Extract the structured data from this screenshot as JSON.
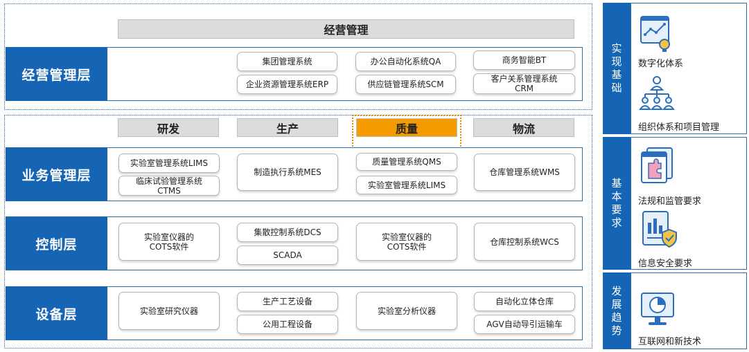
{
  "top": {
    "header": "经营管理",
    "label": "经营管理层",
    "boxes": [
      "集团管理系统",
      "企业资源管理系统ERP",
      "办公自动化系统QA",
      "供应链管理系统SCM",
      "商务智能BT",
      "客户关系管理系统\nCRM"
    ]
  },
  "columns": [
    "研发",
    "生产",
    "质量",
    "物流"
  ],
  "business": {
    "label": "业务管理层",
    "boxes": [
      "实验室管理系统LIMS",
      "临床试验管理系统\nCTMS",
      "制造执行系统MES",
      "质量管理系统QMS",
      "实验室管理系统LIMS",
      "仓库管理系统WMS"
    ]
  },
  "control": {
    "label": "控制层",
    "boxes": [
      "实验室仪器的\nCOTS软件",
      "集散控制系统DCS",
      "SCADA",
      "实验室仪器的\nCOTS软件",
      "仓库控制系统WCS"
    ]
  },
  "device": {
    "label": "设备层",
    "boxes": [
      "实验室研究仪器",
      "生产工艺设备",
      "公用工程设备",
      "实验室分析仪器",
      "自动化立体仓库",
      "AGV自动导引运输车"
    ]
  },
  "side": {
    "basis": {
      "tab": "实现基础",
      "items": [
        "数字化体系",
        "组织体系和项目管理"
      ]
    },
    "requirements": {
      "tab": "基本要求",
      "items": [
        "法规和监管要求",
        "信息安全要求"
      ]
    },
    "trends": {
      "tab": "发展趋势",
      "items": [
        "互联网和新技术"
      ]
    }
  },
  "colors": {
    "label_blue": "#1565b4",
    "quality_orange": "#f59a00",
    "header_gray": "#dcdcdc"
  },
  "icons": [
    "analytics-icon",
    "org-chart-icon",
    "regulation-icon",
    "security-icon",
    "monitor-chart-icon"
  ]
}
